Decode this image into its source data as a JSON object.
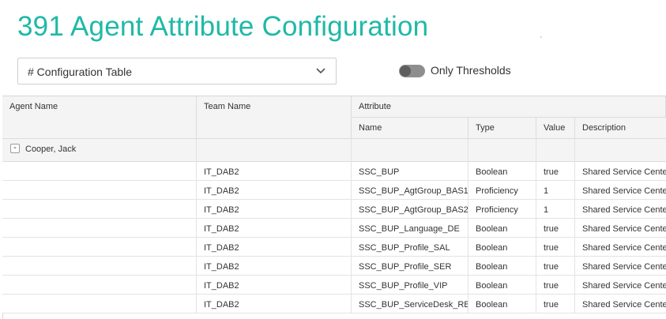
{
  "header": {
    "title": "391 Agent Attribute Configuration"
  },
  "view_select": {
    "value": "# Configuration Table"
  },
  "toggle": {
    "label": "Only Thresholds",
    "on": false
  },
  "table": {
    "headers": {
      "agent_name": "Agent Name",
      "team_name": "Team Name",
      "attribute": "Attribute",
      "name": "Name",
      "type": "Type",
      "value": "Value",
      "description": "Description"
    },
    "group": {
      "toggle_symbol": "-",
      "name": "Cooper, Jack"
    },
    "rows": [
      {
        "team": "IT_DAB2",
        "name": "SSC_BUP",
        "type": "Boolean",
        "value": "true",
        "description": "Shared Service Center"
      },
      {
        "team": "IT_DAB2",
        "name": "SSC_BUP_AgtGroup_BAS1",
        "type": "Proficiency",
        "value": "1",
        "description": "Shared Service Center"
      },
      {
        "team": "IT_DAB2",
        "name": "SSC_BUP_AgtGroup_BAS2",
        "type": "Proficiency",
        "value": "1",
        "description": "Shared Service Center"
      },
      {
        "team": "IT_DAB2",
        "name": "SSC_BUP_Language_DE",
        "type": "Boolean",
        "value": "true",
        "description": "Shared Service Center"
      },
      {
        "team": "IT_DAB2",
        "name": "SSC_BUP_Profile_SAL",
        "type": "Boolean",
        "value": "true",
        "description": "Shared Service Center"
      },
      {
        "team": "IT_DAB2",
        "name": "SSC_BUP_Profile_SER",
        "type": "Boolean",
        "value": "true",
        "description": "Shared Service Center"
      },
      {
        "team": "IT_DAB2",
        "name": "SSC_BUP_Profile_VIP",
        "type": "Boolean",
        "value": "true",
        "description": "Shared Service Center"
      },
      {
        "team": "IT_DAB2",
        "name": "SSC_BUP_ServiceDesk_RBA",
        "type": "Boolean",
        "value": "true",
        "description": "Shared Service Center"
      }
    ]
  },
  "colors": {
    "accent": "#1fb9a6",
    "header_bg": "#f4f4f4",
    "toggle_track": "#8e8e8e"
  },
  "icons": {
    "select_chevron": "chevron-down-icon"
  }
}
